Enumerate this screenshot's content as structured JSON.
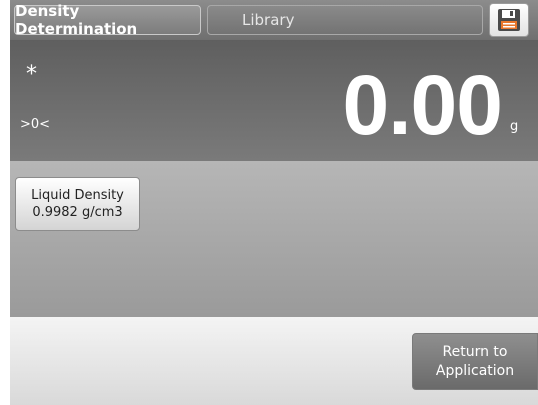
{
  "header": {
    "active_tab": "Density Determination",
    "library_tab": "Library",
    "save_icon": "floppy-disk-save-icon"
  },
  "display": {
    "stable_indicator": "*",
    "center_zero": ">0<",
    "weight_value": "0.00",
    "unit": "g"
  },
  "reference": {
    "label": "Liquid Density",
    "value": "0.9982 g/cm3"
  },
  "footer": {
    "return_line1": "Return to",
    "return_line2": "Application"
  },
  "colors": {
    "display_bg": "#6b6b6b",
    "accent_orange": "#e8762b"
  }
}
